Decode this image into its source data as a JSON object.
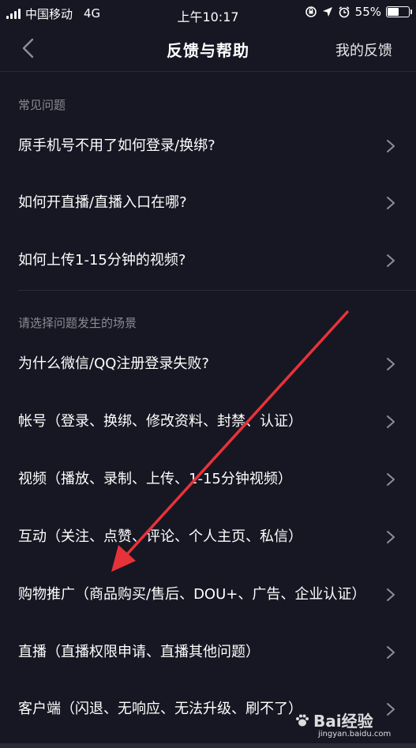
{
  "status_bar": {
    "carrier": "中国移动",
    "network": "4G",
    "time": "上午10:17",
    "battery_percent": "55%",
    "battery_level": 0.55
  },
  "nav": {
    "title": "反馈与帮助",
    "right_link": "我的反馈"
  },
  "sections": {
    "faq_header": "常见问题",
    "faq_items": [
      {
        "label": "原手机号不用了如何登录/换绑?"
      },
      {
        "label": "如何开直播/直播入口在哪?"
      },
      {
        "label": "如何上传1-15分钟的视频?"
      }
    ],
    "scene_header": "请选择问题发生的场景",
    "scene_items": [
      {
        "label": "为什么微信/QQ注册登录失败?"
      },
      {
        "label": "帐号（登录、换绑、修改资料、封禁、认证）"
      },
      {
        "label": "视频（播放、录制、上传、1-15分钟视频）"
      },
      {
        "label": "互动（关注、点赞、评论、个人主页、私信）"
      },
      {
        "label": "购物推广（商品购买/售后、DOU+、广告、企业认证）"
      },
      {
        "label": "直播（直播权限申请、直播其他问题）"
      },
      {
        "label": "客户端（闪退、无响应、无法升级、刷不了）"
      }
    ]
  },
  "watermark": {
    "brand": "Bai经验",
    "url": "jingyan.baidu.com"
  },
  "annotation": {
    "arrow_color": "#e8323a"
  }
}
